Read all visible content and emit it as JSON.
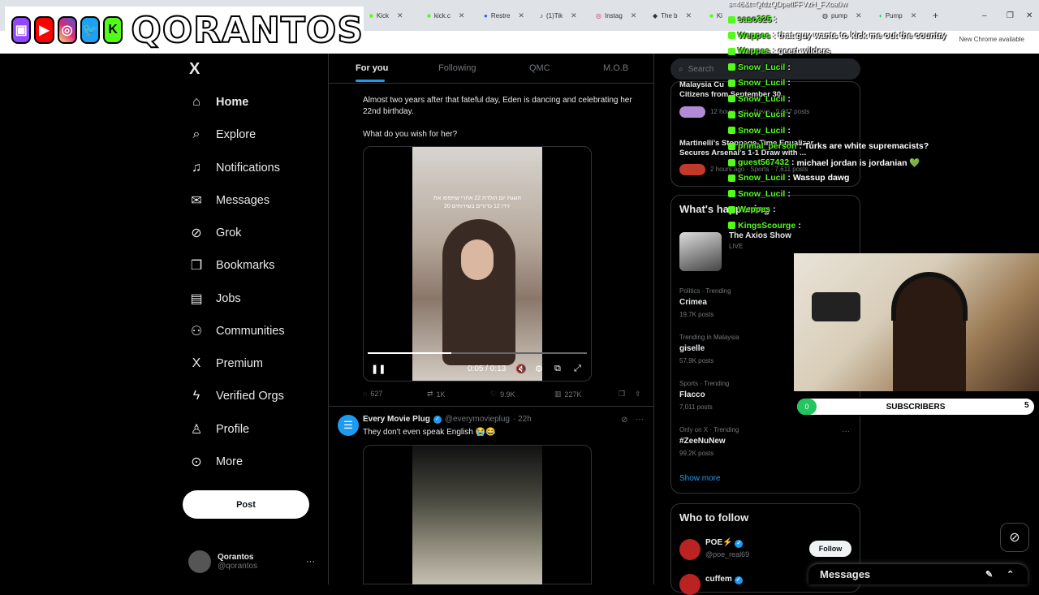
{
  "browser": {
    "tabs": [
      {
        "label": "Kick"
      },
      {
        "label": "kick.c"
      },
      {
        "label": "Restre"
      },
      {
        "label": "(1)Tik"
      },
      {
        "label": "Instag"
      },
      {
        "label": "The b"
      },
      {
        "label": "Ki"
      },
      {
        "label": "pump"
      },
      {
        "label": "Pump"
      }
    ],
    "new_tab": "+",
    "chrome_badge": "New Chrome available",
    "top_url": "s=46&t=QfdzQDpeflFFVzH_FXoa0w"
  },
  "banner": {
    "name": "QORANTOS",
    "socials": [
      "twitch-icon",
      "youtube-icon",
      "instagram-icon",
      "twitter-icon",
      "kick-icon"
    ]
  },
  "nav": {
    "logo": "X",
    "items": [
      {
        "label": "Home",
        "icon": "home-icon",
        "glyph": "⌂",
        "active": true
      },
      {
        "label": "Explore",
        "icon": "search-icon",
        "glyph": "⌕"
      },
      {
        "label": "Notifications",
        "icon": "bell-icon",
        "glyph": "🔔"
      },
      {
        "label": "Messages",
        "icon": "mail-icon",
        "glyph": "✉"
      },
      {
        "label": "Grok",
        "icon": "grok-icon",
        "glyph": "⊘"
      },
      {
        "label": "Bookmarks",
        "icon": "bookmark-icon",
        "glyph": "🔖"
      },
      {
        "label": "Jobs",
        "icon": "briefcase-icon",
        "glyph": "💼"
      },
      {
        "label": "Communities",
        "icon": "people-icon",
        "glyph": "👥"
      },
      {
        "label": "Premium",
        "icon": "x-icon",
        "glyph": "X"
      },
      {
        "label": "Verified Orgs",
        "icon": "lightning-icon",
        "glyph": "ϟ"
      },
      {
        "label": "Profile",
        "icon": "person-icon",
        "glyph": "👤"
      },
      {
        "label": "More",
        "icon": "more-circle-icon",
        "glyph": "⋯"
      }
    ],
    "post_label": "Post",
    "account": {
      "name": "Qorantos",
      "handle": "@qorantos",
      "menu": "···"
    }
  },
  "feed": {
    "tabs": [
      "For you",
      "Following",
      "QMC",
      "M.O.B"
    ],
    "tweet1": {
      "text_line1": "Almost two years after that fateful day, Eden is dancing and celebrating her",
      "text_line2": "22nd birthday.",
      "text_line3": "What do you wish for her?",
      "video_caption_line1": "חוגגת יום הולדת 22 אחרי שתפסו את",
      "video_caption_line2": "20 ירדו 12 כדורים בשירותים",
      "time": "0:05 / 0:13",
      "progress": 0.38,
      "stats": {
        "replies": "627",
        "reposts": "1K",
        "likes": "9.9K",
        "views": "227K"
      }
    },
    "tweet2": {
      "name": "Every Movie Plug",
      "handle": "@everymovieplug",
      "time": "· 22h",
      "text": "They don't even speak English 😭😂"
    }
  },
  "right": {
    "search_placeholder": "Search",
    "news": [
      {
        "title_line1": "Malaysia Cu",
        "title_line2": "Citizens from September 30",
        "meta": "12 hours ago · News · 9,947 posts"
      },
      {
        "title_line1": "Martinelli's Stoppage-Time Equalizer",
        "title_line2": "Secures Arsenal's 1-1 Draw with ...",
        "meta": "2 hours ago · Sports · 7,611 posts"
      }
    ],
    "whats_happening": "What's happening",
    "live_show": {
      "name": "The Axios Show",
      "status": "LIVE"
    },
    "trends": [
      {
        "meta": "Politics · Trending",
        "name": "Crimea",
        "count": "19.7K posts"
      },
      {
        "meta": "Trending in Malaysia",
        "name": "giselle",
        "count": "57.9K posts"
      },
      {
        "meta": "Sports · Trending",
        "name": "Flacco",
        "count": "7,011 posts"
      },
      {
        "meta": "Only on X · Trending",
        "name": "#ZeeNuNew",
        "count": "99.2K posts"
      }
    ],
    "show_more": "Show more",
    "who_to_follow": "Who to follow",
    "follow_suggestions": [
      {
        "name": "POE⚡",
        "handle": "@poe_real69"
      },
      {
        "name": "cuffem",
        "handle": ""
      }
    ],
    "follow_label": "Follow",
    "messages_label": "Messages"
  },
  "chat": [
    {
      "user": "saso325",
      "msg": ""
    },
    {
      "user": "Weppes",
      "msg": "that guy wants to kick me out the country"
    },
    {
      "user": "Weppes",
      "msg": "geert wilders"
    },
    {
      "user": "Snow_Lucil",
      "msg": ""
    },
    {
      "user": "Snow_Lucil",
      "msg": ""
    },
    {
      "user": "Snow_Lucil",
      "msg": ""
    },
    {
      "user": "Snow_Lucil",
      "msg": ""
    },
    {
      "user": "Snow_Lucil",
      "msg": ""
    },
    {
      "user": "primal_person",
      "msg": "Turks are white supremacists?"
    },
    {
      "user": "guest567432",
      "msg": "michael jordan is jordanian 💚"
    },
    {
      "user": "Snow_Lucil",
      "msg": "Wassup dawg"
    },
    {
      "user": "Snow_Lucil",
      "msg": ""
    },
    {
      "user": "Weppes",
      "msg": ""
    },
    {
      "user": "KingsScourge",
      "msg": ""
    }
  ],
  "subs": {
    "label": "SUBSCRIBERS",
    "current": "0",
    "goal": "5"
  },
  "colors": {
    "accent": "#1d9bf0",
    "kick_green": "#53fc18",
    "bg": "#000000"
  }
}
